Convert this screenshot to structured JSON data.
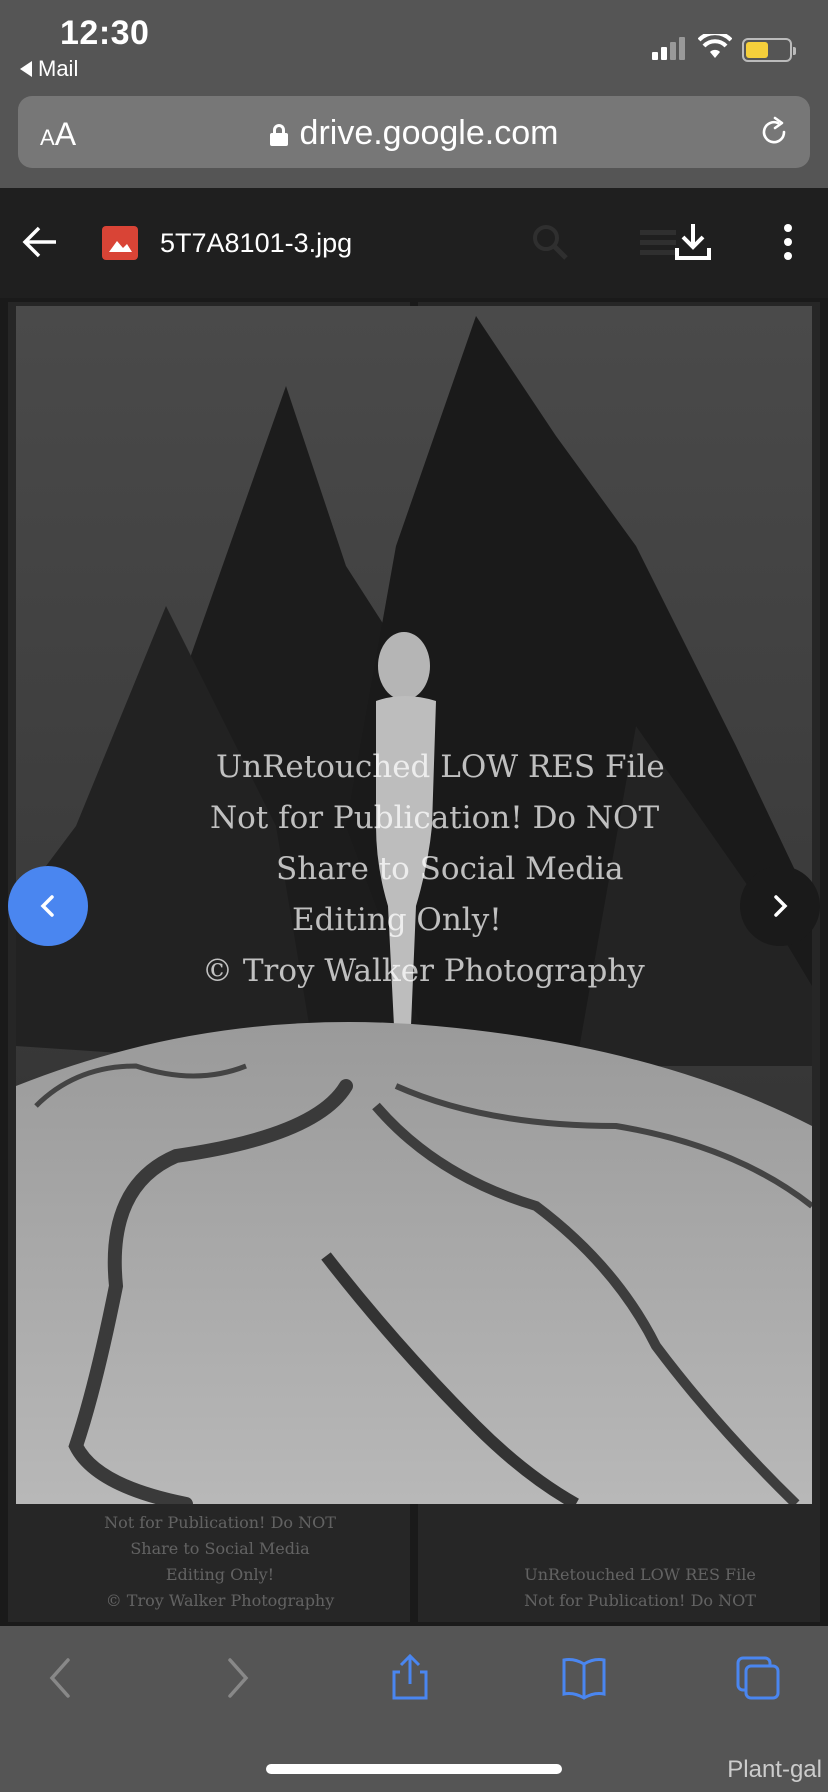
{
  "status_bar": {
    "time": "12:30",
    "back_app": "Mail",
    "battery_color": "#f5cf3b"
  },
  "browser": {
    "text_size_label": "AA",
    "url": "drive.google.com"
  },
  "drive_toolbar": {
    "file_name": "5T7A8101-3.jpg",
    "back_icon": "arrow-left-icon",
    "file_type_icon": "image-file-icon",
    "download_icon": "download-icon",
    "more_icon": "more-vertical-icon"
  },
  "viewer": {
    "watermark_lines": [
      "UnRetouched LOW RES File",
      "Not for Publication!  Do NOT",
      "Share to Social Media",
      "Editing Only!",
      "© Troy Walker Photography"
    ],
    "prev_icon": "chevron-left-icon",
    "next_icon": "chevron-right-icon",
    "prev_accent": "#4a86f0"
  },
  "background_thumbnails": {
    "left_watermark": [
      "Not for Publication!  Do NOT",
      "Share to Social Media",
      "Editing Only!",
      "© Troy Walker Photography"
    ],
    "right_watermark": [
      "UnRetouched LOW RES File",
      "Not for Publication!  Do NOT"
    ]
  },
  "safari_toolbar": {
    "items": [
      "back-icon",
      "forward-icon",
      "share-icon",
      "bookmarks-icon",
      "tabs-icon"
    ]
  },
  "caption": "Plant-gal"
}
